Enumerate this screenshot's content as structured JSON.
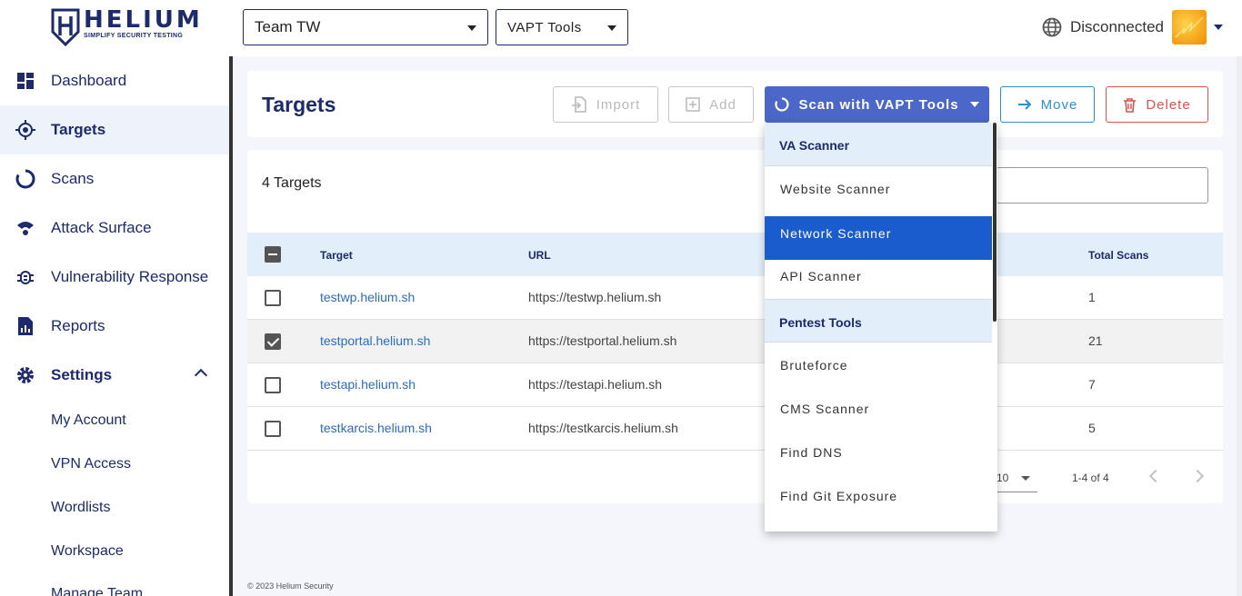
{
  "header": {
    "logo_title": "HELIUM",
    "logo_subtitle": "SIMPLIFY SECURITY TESTING",
    "team_select": "Team TW",
    "tools_select": "VAPT Tools",
    "connection_status": "Disconnected"
  },
  "sidebar": {
    "items": [
      {
        "label": "Dashboard",
        "icon": "dashboard-icon"
      },
      {
        "label": "Targets",
        "icon": "target-icon"
      },
      {
        "label": "Scans",
        "icon": "scans-icon"
      },
      {
        "label": "Attack Surface",
        "icon": "wifi-icon"
      },
      {
        "label": "Vulnerability Response",
        "icon": "bug-icon"
      },
      {
        "label": "Reports",
        "icon": "report-icon"
      },
      {
        "label": "Settings",
        "icon": "gear-icon"
      }
    ],
    "settings_sub": [
      "My Account",
      "VPN Access",
      "Wordlists",
      "Workspace",
      "Manage Team"
    ]
  },
  "page": {
    "title": "Targets",
    "count_label": "4 Targets",
    "footer": "© 2023 Helium Security"
  },
  "toolbar": {
    "import": "Import",
    "add": "Add",
    "scan": "Scan with VAPT Tools",
    "move": "Move",
    "delete": "Delete"
  },
  "table": {
    "headers": {
      "target": "Target",
      "url": "URL",
      "total_scans": "Total Scans"
    },
    "rows": [
      {
        "target": "testwp.helium.sh",
        "url": "https://testwp.helium.sh",
        "scans": "1",
        "checked": false
      },
      {
        "target": "testportal.helium.sh",
        "url": "https://testportal.helium.sh",
        "scans": "21",
        "checked": true
      },
      {
        "target": "testapi.helium.sh",
        "url": "https://testapi.helium.sh",
        "scans": "7",
        "checked": false
      },
      {
        "target": "testkarcis.helium.sh",
        "url": "https://testkarcis.helium.sh",
        "scans": "5",
        "checked": false
      }
    ]
  },
  "pagination": {
    "rows_per_page": "10",
    "range": "1-4 of 4"
  },
  "scan_menu": {
    "group1": "VA Scanner",
    "group1_items": [
      "Website Scanner",
      "Network Scanner",
      "API Scanner"
    ],
    "group2": "Pentest Tools",
    "group2_items": [
      "Bruteforce",
      "CMS Scanner",
      "Find DNS",
      "Find Git Exposure"
    ],
    "highlighted": "Network Scanner"
  },
  "colors": {
    "brand": "#1d2a6b",
    "primary": "#4a67c9",
    "move": "#2d8fd0",
    "delete": "#d9534f",
    "highlight": "#1a5bcd"
  }
}
